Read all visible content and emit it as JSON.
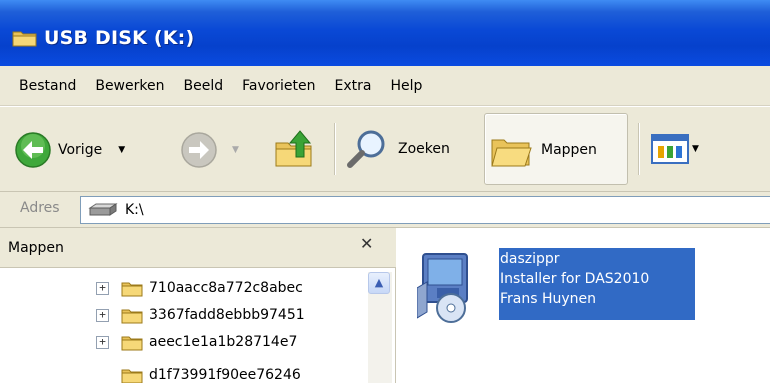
{
  "window": {
    "title": "USB DISK (K:)"
  },
  "menu": [
    "Bestand",
    "Bewerken",
    "Beeld",
    "Favorieten",
    "Extra",
    "Help"
  ],
  "toolbar": {
    "back_label": "Vorige",
    "search_label": "Zoeken",
    "folders_label": "Mappen"
  },
  "address": {
    "label": "Adres",
    "value": "K:\\"
  },
  "folders_pane": {
    "title": "Mappen",
    "items": [
      {
        "label": "710aacc8a772c8abec",
        "expander": "+"
      },
      {
        "label": "3367fadd8ebbb97451",
        "expander": "+"
      },
      {
        "label": "aeec1e1a1b28714e7",
        "expander": "+"
      },
      {
        "label": "d1f73991f90ee76246",
        "expander": ""
      }
    ]
  },
  "content": {
    "item": {
      "name": "daszippr",
      "description": "Installer for DAS2010",
      "company": "Frans Huynen"
    }
  },
  "colors": {
    "title_bar": "#0a49d6",
    "selection": "#316ac5",
    "chrome": "#ece9d8"
  }
}
